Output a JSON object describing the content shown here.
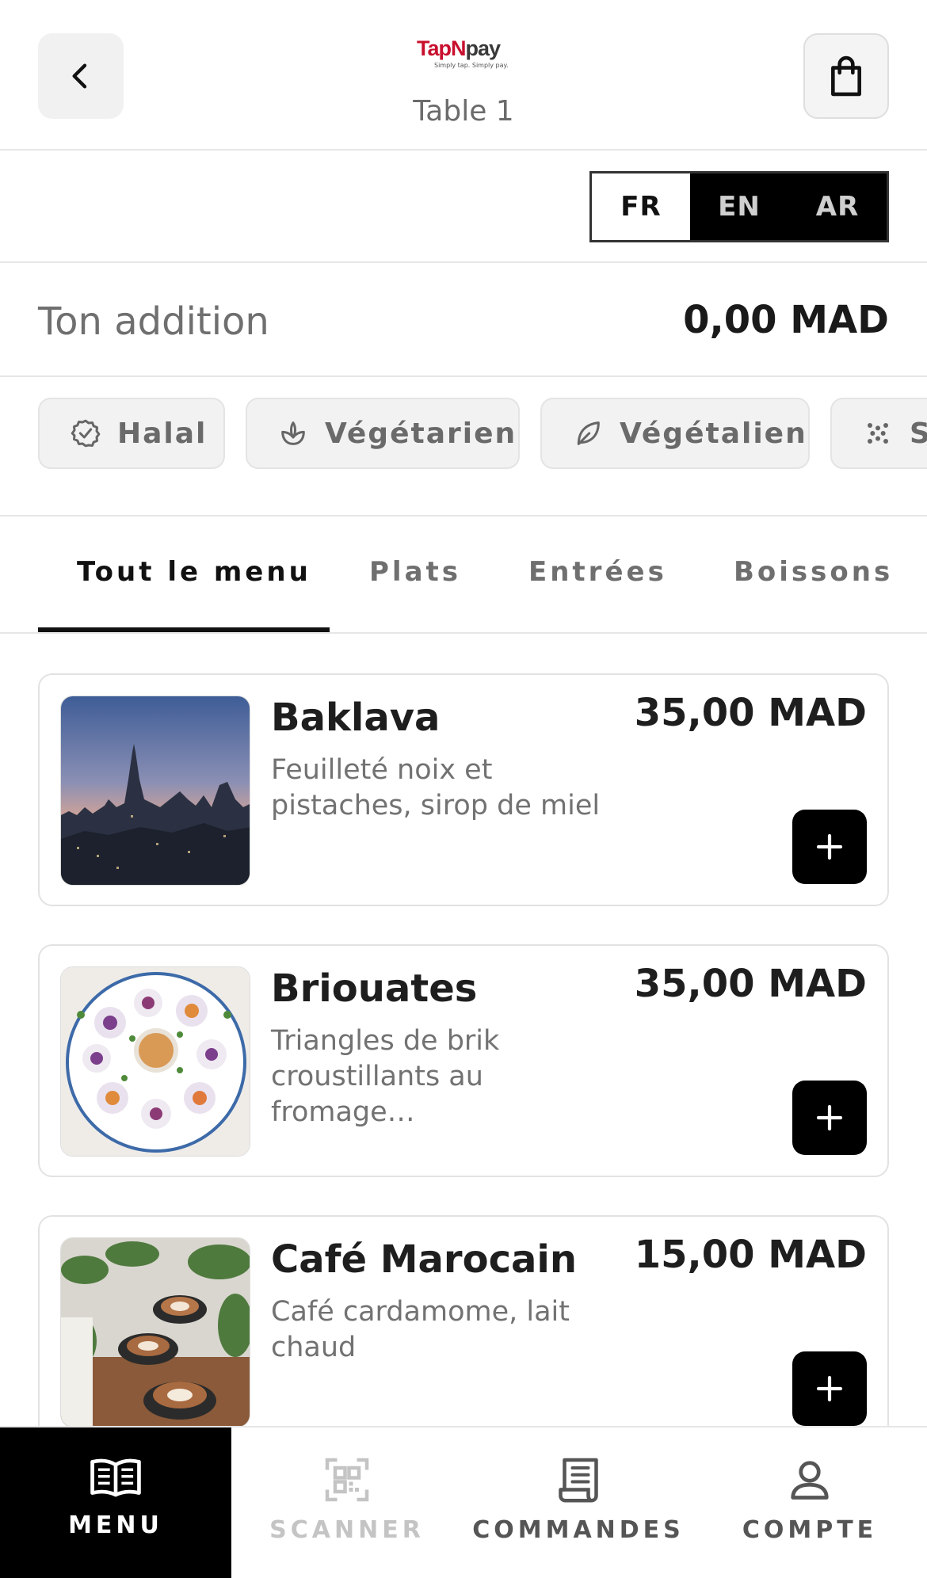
{
  "header": {
    "logo": {
      "brand_left": "Tap",
      "brand_mid": "N",
      "brand_right": "pay",
      "tagline": "Simply tap. Simply pay."
    },
    "table_label": "Table 1",
    "back_icon": "chevron-left-icon",
    "cart_icon": "shopping-bag-icon"
  },
  "languages": {
    "options": [
      "FR",
      "EN",
      "AR"
    ],
    "selected": "FR"
  },
  "bill": {
    "label": "Ton addition",
    "amount": "0,00 MAD"
  },
  "filters": [
    {
      "label": "Halal",
      "icon": "halal-badge-icon"
    },
    {
      "label": "Végétarien",
      "icon": "sprout-icon"
    },
    {
      "label": "Végétalien",
      "icon": "leaf-icon"
    },
    {
      "label": "S",
      "icon": "dots-icon"
    }
  ],
  "tabs": {
    "items": [
      "Tout le menu",
      "Plats",
      "Entrées",
      "Boissons"
    ],
    "active": "Tout le menu"
  },
  "menu_items": [
    {
      "name": "Baklava",
      "description": "Feuilleté noix et pistaches, sirop de miel",
      "price": "35,00 MAD"
    },
    {
      "name": "Briouates",
      "description": "Triangles de brik croustillants au fromage…",
      "price": "35,00 MAD"
    },
    {
      "name": "Café Marocain",
      "description": "Café cardamome, lait chaud",
      "price": "15,00 MAD"
    }
  ],
  "bottom_nav": {
    "items": [
      {
        "label": "MENU",
        "icon": "open-book-icon",
        "state": "active"
      },
      {
        "label": "SCANNER",
        "icon": "qr-code-icon",
        "state": "disabled"
      },
      {
        "label": "COMMANDES",
        "icon": "receipt-icon",
        "state": "normal"
      },
      {
        "label": "COMPTE",
        "icon": "user-icon",
        "state": "normal"
      }
    ]
  },
  "colors": {
    "accent": "#000000",
    "brand_red": "#c8102e",
    "muted_text": "#6f6f6f",
    "chip_bg": "#f2f2f2"
  }
}
